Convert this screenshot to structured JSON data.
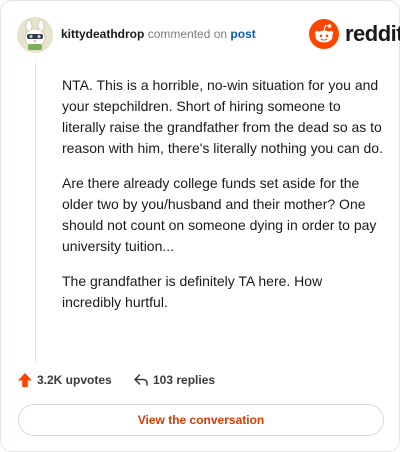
{
  "comment": {
    "username": "kittydeathdrop",
    "action_text": "commented on",
    "post_link": "post",
    "paragraphs": [
      "NTA. This is a horrible, no-win situation for you and your stepchildren. Short of hiring someone to literally raise the grandfather from the dead so as to reason with him, there's literally nothing you can do.",
      "Are there already college funds set aside for the older two by you/husband and their mother? One should not count on someone dying in order to pay university tuition...",
      "The grandfather is definitely TA here. How incredibly hurtful."
    ],
    "upvotes": "3.2K upvotes",
    "replies": "103 replies"
  },
  "brand": {
    "name": "reddit",
    "color": "#ff4500"
  },
  "cta": {
    "label": "View the conversation"
  },
  "colors": {
    "accent": "#d93a00",
    "upvote": "#ff4500",
    "link": "#0a5fb4"
  },
  "icons": [
    "avatar-image",
    "reddit-logo-icon",
    "upvote-arrow-icon",
    "reply-arrow-icon"
  ]
}
